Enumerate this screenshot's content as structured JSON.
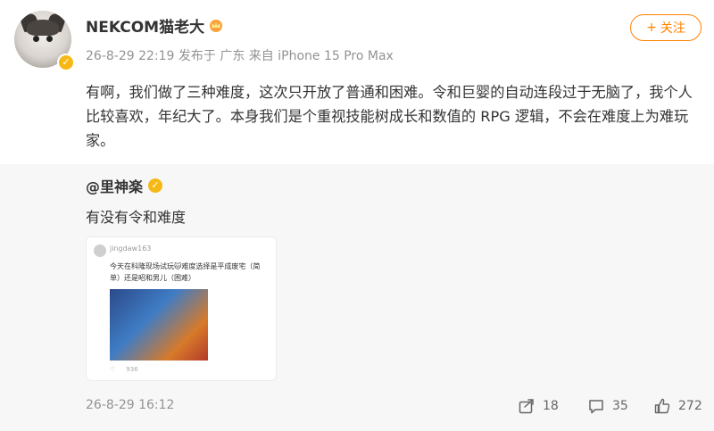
{
  "header": {
    "username": "NEKCOM猫老大",
    "meta": "26-8-29 22:19 发布于 广东 来自 iPhone 15 Pro Max",
    "follow_label": "关注"
  },
  "post": {
    "text": "有啊，我们做了三种难度，这次只开放了普通和困难。令和巨婴的自动连段过于无脑了，我个人比较喜欢，年纪大了。本身我们是个重视技能树成长和数值的 RPG 逻辑，不会在难度上为难玩家。"
  },
  "retweet": {
    "author": "@里神楽",
    "text": "有没有令和难度",
    "image": {
      "username": "jingdaw163",
      "body": "今天在科隆现场试玩🐱难度选择是平成废宅（简单）还是昭和男儿（困难）",
      "likes": "936"
    }
  },
  "footer": {
    "timestamp": "26-8-29 16:12",
    "share_count": "18",
    "comment_count": "35",
    "like_count": "272"
  },
  "colors": {
    "accent": "#ff8200",
    "badge": "#f6b814",
    "muted": "#939393"
  }
}
